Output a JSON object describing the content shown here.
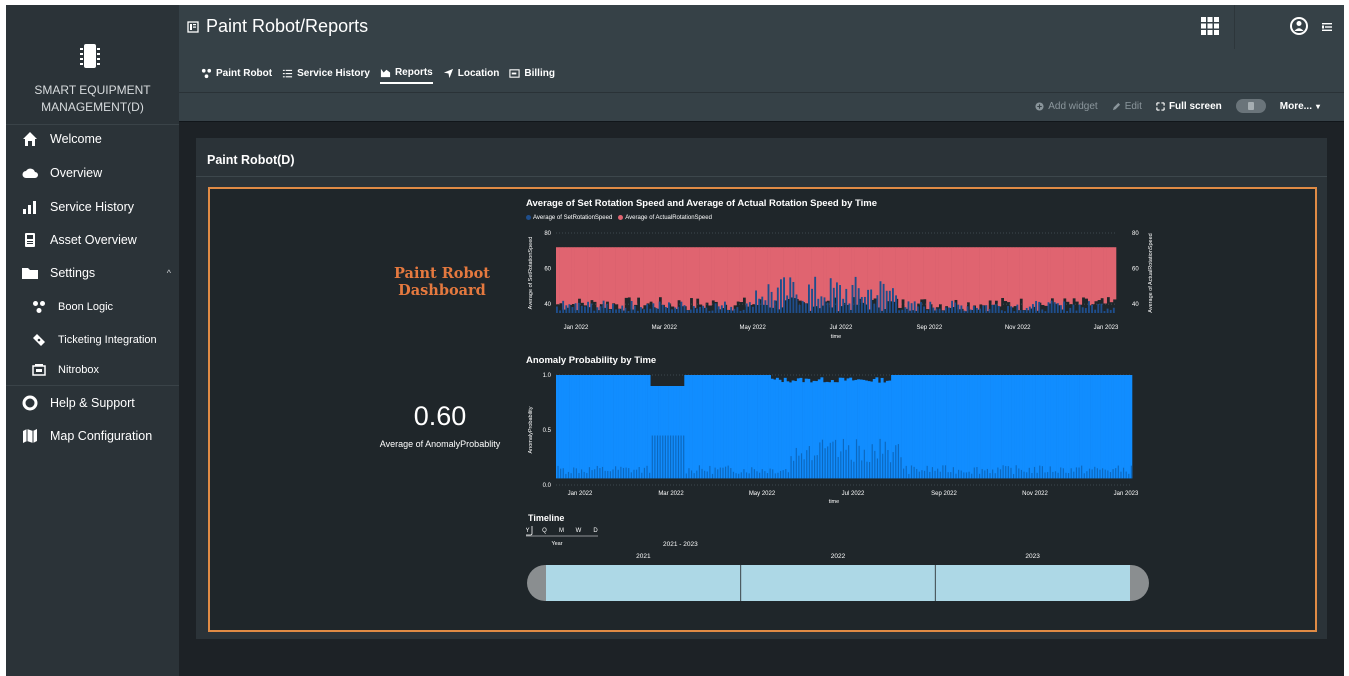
{
  "sidebar": {
    "brand_name_line1": "SMART EQUIPMENT",
    "brand_name_line2": "MANAGEMENT(D)",
    "items": [
      {
        "label": "Welcome",
        "icon": "home-icon"
      },
      {
        "label": "Overview",
        "icon": "cloud-icon"
      },
      {
        "label": "Service History",
        "icon": "bar-chart-icon"
      },
      {
        "label": "Asset Overview",
        "icon": "device-icon"
      },
      {
        "label": "Settings",
        "icon": "folder-icon",
        "caret": "^"
      },
      {
        "label": "Boon Logic",
        "icon": "nodes-icon"
      },
      {
        "label": "Ticketing Integration",
        "icon": "ticket-icon"
      },
      {
        "label": "Nitrobox",
        "icon": "billing-box-icon"
      },
      {
        "label": "Help & Support",
        "icon": "lifebuoy-icon"
      },
      {
        "label": "Map Configuration",
        "icon": "map-icon"
      }
    ]
  },
  "header": {
    "title": "Paint Robot/Reports",
    "tabs": [
      {
        "label": "Paint Robot",
        "icon": "nodes-icon"
      },
      {
        "label": "Service History",
        "icon": "list-icon"
      },
      {
        "label": "Reports",
        "icon": "report-icon",
        "active": true
      },
      {
        "label": "Location",
        "icon": "location-arrow-icon"
      },
      {
        "label": "Billing",
        "icon": "billing-icon"
      }
    ]
  },
  "toolbar": {
    "add_widget": "Add widget",
    "edit": "Edit",
    "full_screen": "Full screen",
    "more": "More..."
  },
  "panel": {
    "title": "Paint Robot(D)",
    "dashboard_title_line1": "Paint Robot",
    "dashboard_title_line2": "Dashboard",
    "kpi_value": "0.60",
    "kpi_label": "Average of AnomalyProbablity"
  },
  "colors": {
    "accent_orange": "#e08b45",
    "set_speed_blue": "#1f4e8c",
    "actual_speed_red": "#e06470",
    "anomaly_blue": "#118dff",
    "timeline_fill": "#add8e6"
  },
  "chart_data": [
    {
      "type": "bar",
      "title": "Average of Set Rotation Speed and Average of Actual Rotation Speed by Time",
      "xlabel": "time",
      "ylabel": "Average of SetRotationSpeed",
      "ylabel_right": "Average of ActualRotationSpeed",
      "x_ticks": [
        "Jan 2022",
        "Mar 2022",
        "May 2022",
        "Jul 2022",
        "Sep 2022",
        "Nov 2022",
        "Jan 2023"
      ],
      "y_ticks": [
        40,
        60,
        80
      ],
      "ylim": [
        35,
        80
      ],
      "series": [
        {
          "name": "Average of SetRotationSpeed",
          "color": "#1f4e8c",
          "values": [
            37,
            37,
            37,
            38,
            37,
            37,
            37
          ]
        },
        {
          "name": "Average of ActualRotationSpeed",
          "color": "#e06470",
          "values": [
            72,
            72,
            72,
            72,
            72,
            72,
            72
          ]
        }
      ]
    },
    {
      "type": "bar",
      "title": "Anomaly Probability by Time",
      "xlabel": "time",
      "ylabel": "AnomalyProbability",
      "x_ticks": [
        "Jan 2022",
        "Mar 2022",
        "May 2022",
        "Jul 2022",
        "Sep 2022",
        "Nov 2022",
        "Jan 2023"
      ],
      "y_ticks": [
        0.0,
        0.5,
        1.0
      ],
      "ylim": [
        0,
        1
      ],
      "series": [
        {
          "name": "AnomalyProbability",
          "color": "#118dff",
          "values": [
            1.0,
            1.0,
            1.0,
            1.0,
            1.0,
            1.0,
            1.0
          ]
        }
      ]
    },
    {
      "type": "table",
      "title": "Timeline",
      "granularity": [
        "Y",
        "Q",
        "M",
        "W",
        "D"
      ],
      "granularity_selected": "Year",
      "range_label": "2021 - 2023",
      "years": [
        "2021",
        "2022",
        "2023"
      ]
    }
  ]
}
